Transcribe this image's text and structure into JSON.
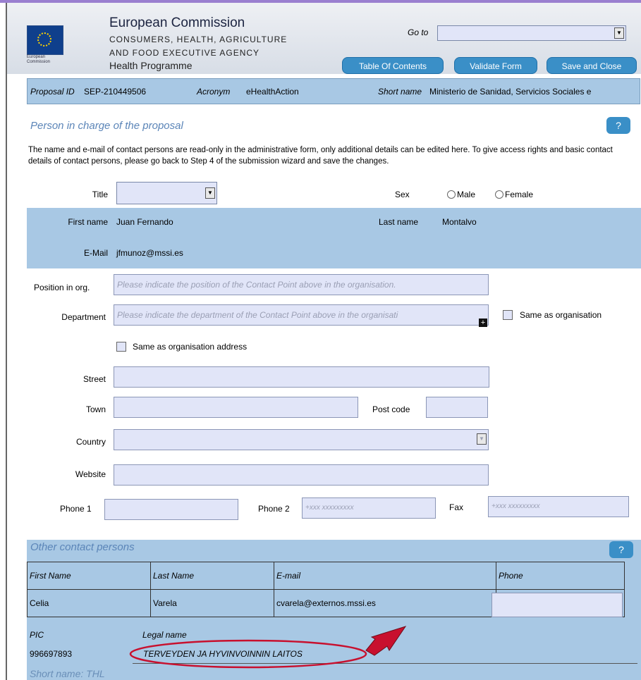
{
  "header": {
    "org_title": "European Commission",
    "org_line1": "CONSUMERS, HEALTH, AGRICULTURE",
    "org_line2": "AND FOOD EXECUTIVE AGENCY",
    "programme": "Health Programme",
    "logo_text": "European Commission",
    "goto_label": "Go to",
    "buttons": {
      "toc": "Table Of Contents",
      "validate": "Validate Form",
      "save_close": "Save and Close"
    }
  },
  "proposal": {
    "id_label": "Proposal ID",
    "id_value": "SEP-210449506",
    "acronym_label": "Acronym",
    "acronym_value": "eHealthAction",
    "short_name_label": "Short name",
    "short_name_value": "Ministerio de Sanidad, Servicios Sociales e"
  },
  "person": {
    "section_title": "Person in charge of the proposal",
    "help": "?",
    "intro": "The name and e-mail of contact persons are read-only in the administrative form, only additional details can be edited here. To give access rights and basic contact details of contact persons, please go back to Step 4 of the submission wizard and save the changes.",
    "title_label": "Title",
    "sex_label": "Sex",
    "male_label": "Male",
    "female_label": "Female",
    "first_name_label": "First name",
    "first_name_value": "Juan Fernando",
    "last_name_label": "Last name",
    "last_name_value": "Montalvo",
    "email_label": "E-Mail",
    "email_value": "jfmunoz@mssi.es",
    "position_label": "Position in org.",
    "position_placeholder": "Please indicate the position of the Contact Point above in the organisation.",
    "department_label": "Department",
    "department_placeholder": "Please indicate the department of the Contact Point above in the organisati",
    "same_as_org_label": "Same as organisation",
    "same_as_org_address_label": "Same as organisation address",
    "street_label": "Street",
    "town_label": "Town",
    "postcode_label": "Post code",
    "country_label": "Country",
    "website_label": "Website",
    "phone1_label": "Phone 1",
    "phone2_label": "Phone 2",
    "phone2_placeholder": "+xxx xxxxxxxxx",
    "fax_label": "Fax",
    "fax_placeholder": "+xxx xxxxxxxxx"
  },
  "other": {
    "section_title": "Other contact persons",
    "help": "?",
    "columns": [
      "First Name",
      "Last Name",
      "E-mail",
      "Phone"
    ],
    "rows": [
      {
        "first": "Celia",
        "last": "Varela",
        "email": "cvarela@externos.mssi.es"
      }
    ],
    "pic_label": "PIC",
    "pic_value": "996697893",
    "legal_name_label": "Legal name",
    "legal_name_value": "TERVEYDEN JA HYVINVOINNIN LAITOS",
    "short_name_label": "Short name: THL"
  },
  "colors": {
    "band": "#a8c8e4",
    "button": "#3a8fc7",
    "annotation": "#c8102e"
  }
}
